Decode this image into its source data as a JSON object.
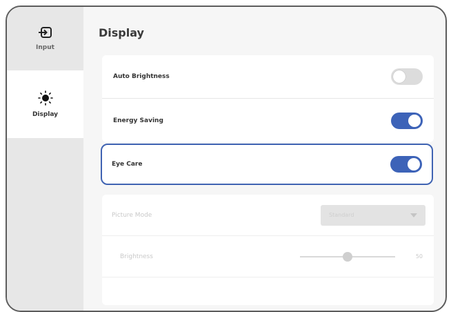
{
  "sidebar": {
    "items": [
      {
        "label": "Input",
        "icon": "input-icon"
      },
      {
        "label": "Display",
        "icon": "brightness-icon"
      }
    ]
  },
  "page": {
    "title": "Display"
  },
  "settings": {
    "auto_brightness": {
      "label": "Auto Brightness",
      "enabled": false
    },
    "energy_saving": {
      "label": "Energy Saving",
      "enabled": true
    },
    "eye_care": {
      "label": "Eye Care",
      "enabled": true
    }
  },
  "disabled_settings": {
    "picture_mode": {
      "label": "Picture Mode",
      "value": "Standard"
    },
    "brightness": {
      "label": "Brightness",
      "value": "50",
      "level": 0.5
    }
  },
  "colors": {
    "accent": "#3d63b8",
    "sidebar_bg": "#e7e7e7",
    "toggle_off": "#dcdcdc"
  }
}
